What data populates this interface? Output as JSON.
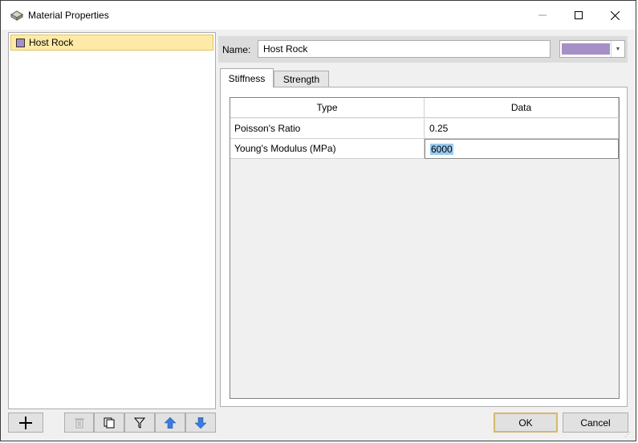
{
  "window": {
    "title": "Material Properties"
  },
  "materials": [
    {
      "label": "Host Rock",
      "color": "#a68fc7"
    }
  ],
  "name_field": {
    "label": "Name:",
    "value": "Host Rock",
    "color": "#a68fc7"
  },
  "tabs": [
    {
      "label": "Stiffness",
      "active": true
    },
    {
      "label": "Strength",
      "active": false
    }
  ],
  "table": {
    "headers": [
      "Type",
      "Data"
    ],
    "rows": [
      {
        "type": "Poisson's Ratio",
        "data": "0.25"
      },
      {
        "type": "Young's Modulus (MPa)",
        "data": "6000"
      }
    ]
  },
  "toolbar_icons": [
    "add-icon",
    "delete-icon",
    "copy-icon",
    "filter-icon",
    "arrow-up-icon",
    "arrow-down-icon"
  ],
  "footer": {
    "ok_label": "OK",
    "cancel_label": "Cancel"
  }
}
